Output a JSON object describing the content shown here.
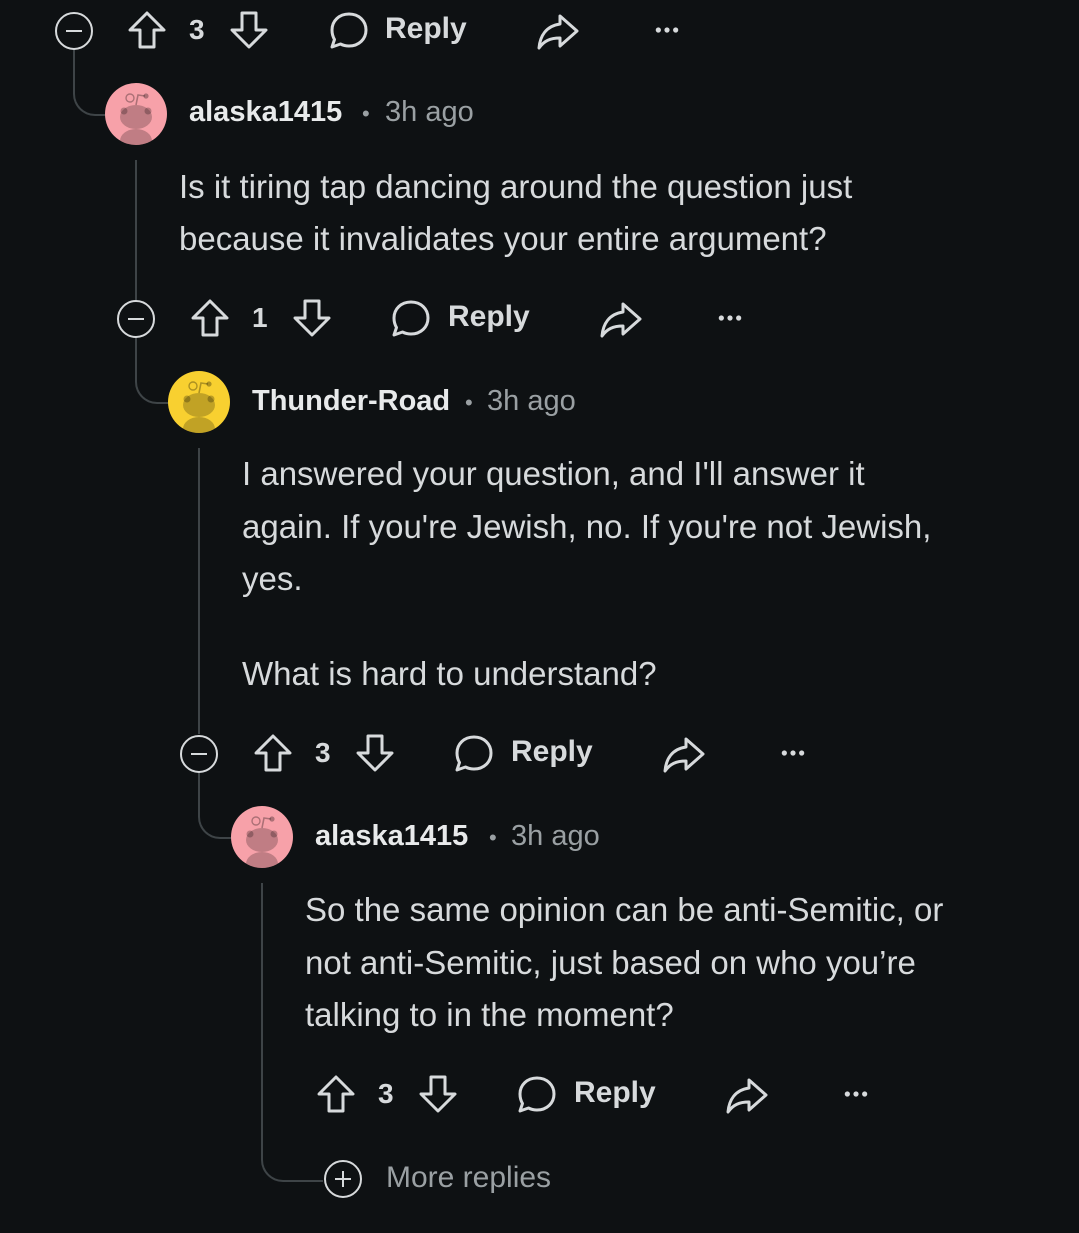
{
  "thread": {
    "top_action_bar": {
      "vote_count": "3",
      "reply_label": "Reply"
    },
    "comments": [
      {
        "username": "alaska1415",
        "time": "3h ago",
        "avatar_color": "#f7a1a9",
        "lines": [
          "Is it tiring tap dancing around the question just",
          "because it invalidates your entire argument?"
        ],
        "vote_count": "1",
        "reply_label": "Reply"
      },
      {
        "username": "Thunder-Road",
        "time": "3h ago",
        "avatar_color": "#f8d030",
        "lines": [
          "I answered your question, and I'll answer it",
          "again. If you're Jewish, no. If you're not Jewish,",
          "yes.",
          "What is hard to understand?"
        ],
        "vote_count": "3",
        "reply_label": "Reply"
      },
      {
        "username": "alaska1415",
        "time": "3h ago",
        "avatar_color": "#f7a1a9",
        "lines": [
          "So the same opinion can be anti-Semitic, or",
          "not anti-Semitic, just based on who you’re",
          "talking to in the moment?"
        ],
        "vote_count": "3",
        "reply_label": "Reply"
      }
    ],
    "more_replies_label": "More replies",
    "separator": "•"
  }
}
